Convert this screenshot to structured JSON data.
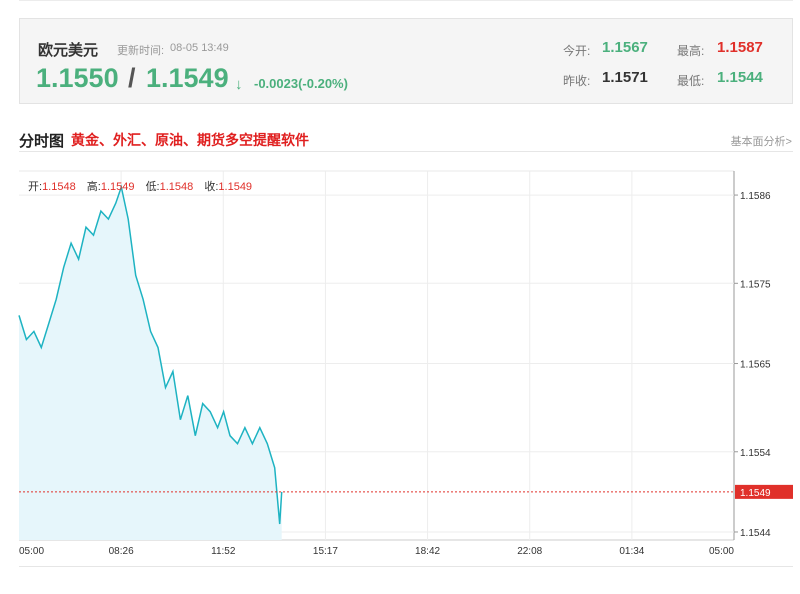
{
  "quote": {
    "pair": "欧元美元",
    "update_label": "更新时间:",
    "update_time": "08-05 13:49",
    "bid": "1.1550",
    "separator": "/",
    "ask": "1.1549",
    "arrow": "↓",
    "change": "-0.0023(-0.20%)",
    "open_label": "今开:",
    "open": "1.1567",
    "high_label": "最高:",
    "high": "1.1587",
    "prev_close_label": "昨收:",
    "prev_close": "1.1571",
    "low_label": "最低:",
    "low": "1.1544"
  },
  "section": {
    "title": "分时图",
    "ad": "黄金、外汇、原油、期货多空提醒软件",
    "fundamental_link": "基本面分析>"
  },
  "ohlc": {
    "open_label": "开:",
    "open": "1.1548",
    "high_label": "高:",
    "high": "1.1549",
    "low_label": "低:",
    "low": "1.1548",
    "close_label": "收:",
    "close": "1.1549"
  },
  "colors": {
    "up": "#e0302a",
    "down": "#4bb07d",
    "line": "#1eb3c2",
    "area": "#e6f6fb",
    "current_price": "#e0302a"
  },
  "chart_data": {
    "type": "area",
    "x_tick_labels": [
      "05:00",
      "08:26",
      "11:52",
      "15:17",
      "18:42",
      "22:08",
      "01:34",
      "05:00"
    ],
    "y_tick_labels": [
      "1.1586",
      "1.1575",
      "1.1565",
      "1.1554",
      "1.1544"
    ],
    "ylim": [
      1.1543,
      1.1589
    ],
    "current_price": "1.1549",
    "grid": true,
    "series": [
      {
        "x": [
          "05:00",
          "05:15",
          "05:30",
          "05:45",
          "06:00",
          "06:15",
          "06:30",
          "06:45",
          "07:00",
          "07:15",
          "07:30",
          "07:45",
          "08:00",
          "08:15",
          "08:26",
          "08:40",
          "08:55",
          "09:10",
          "09:25",
          "09:40",
          "09:55",
          "10:10",
          "10:25",
          "10:40",
          "10:55",
          "11:10",
          "11:25",
          "11:40",
          "11:52",
          "12:05",
          "12:20",
          "12:35",
          "12:50",
          "13:05",
          "13:20",
          "13:35",
          "13:45",
          "13:49"
        ],
        "values": [
          1.1571,
          1.1568,
          1.1569,
          1.1567,
          1.157,
          1.1573,
          1.1577,
          1.158,
          1.1578,
          1.1582,
          1.1581,
          1.1584,
          1.1583,
          1.1585,
          1.1587,
          1.1583,
          1.1576,
          1.1573,
          1.1569,
          1.1567,
          1.1562,
          1.1564,
          1.1558,
          1.1561,
          1.1556,
          1.156,
          1.1559,
          1.1557,
          1.1559,
          1.1556,
          1.1555,
          1.1557,
          1.1555,
          1.1557,
          1.1555,
          1.1552,
          1.1545,
          1.1549
        ]
      }
    ]
  }
}
